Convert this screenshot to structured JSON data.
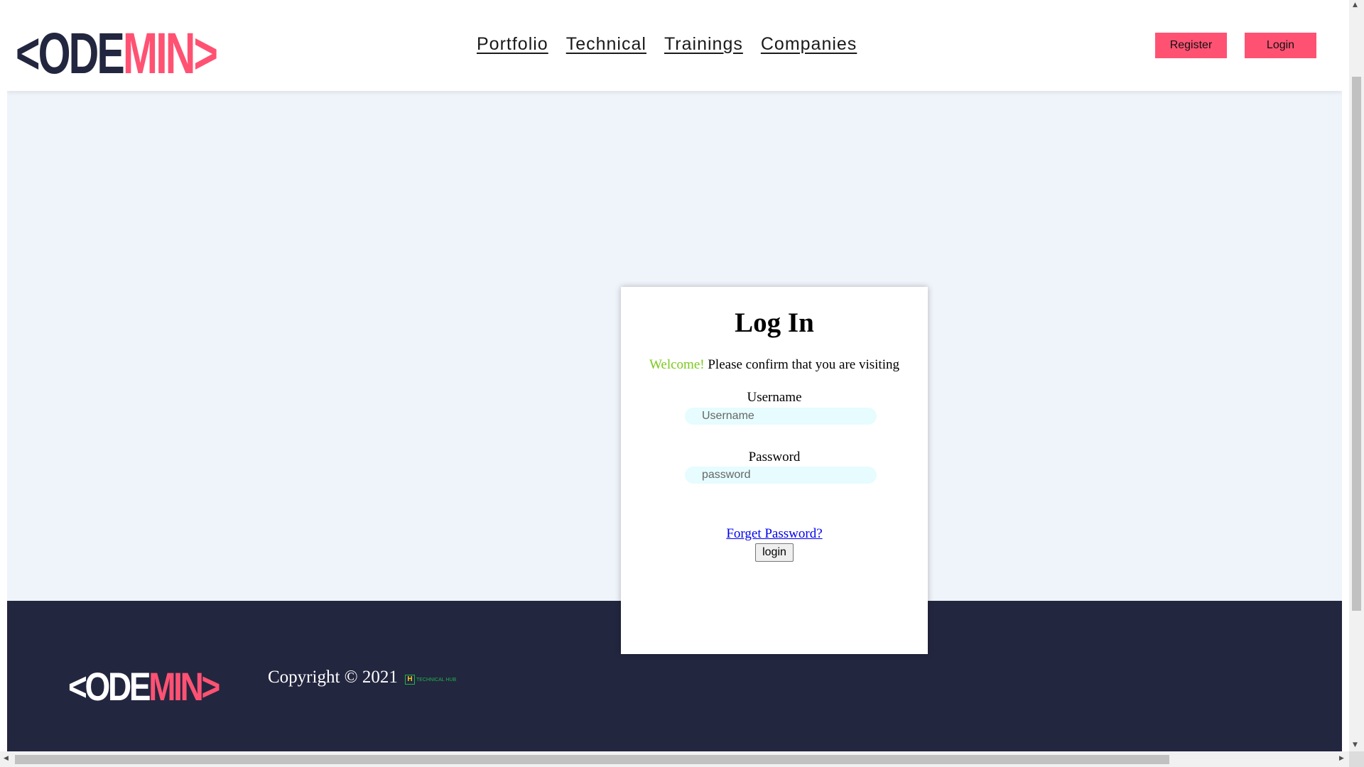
{
  "header": {
    "logo_dark": "<ODE",
    "logo_pink": "MIN>",
    "nav": [
      "Portfolio",
      "Technical",
      "Trainings",
      "Companies"
    ],
    "register_label": "Register",
    "login_label": "Login"
  },
  "login_card": {
    "title": "Log In",
    "welcome_highlight": "Welcome!",
    "welcome_text": " Please confirm that you are visiting",
    "username_label": "Username",
    "username_placeholder": "Username",
    "password_label": "Password",
    "password_placeholder": "password",
    "forgot_label": "Forget Password?",
    "submit_label": "login"
  },
  "footer": {
    "logo_dark": "<ODE",
    "logo_pink": "MIN>",
    "copyright": "Copyright © 2021",
    "badge_letter": "H",
    "badge_text": "TECHNICAL HUB"
  },
  "colors": {
    "accent": "#ff5273",
    "dark": "#23263f",
    "page_bg": "#eff3fa",
    "welcome_green": "#7ac91b",
    "input_bg": "#e6fcff"
  },
  "icons": {
    "scroll_up": "▲",
    "scroll_down": "▼",
    "scroll_left": "◀",
    "scroll_right": "▶"
  }
}
